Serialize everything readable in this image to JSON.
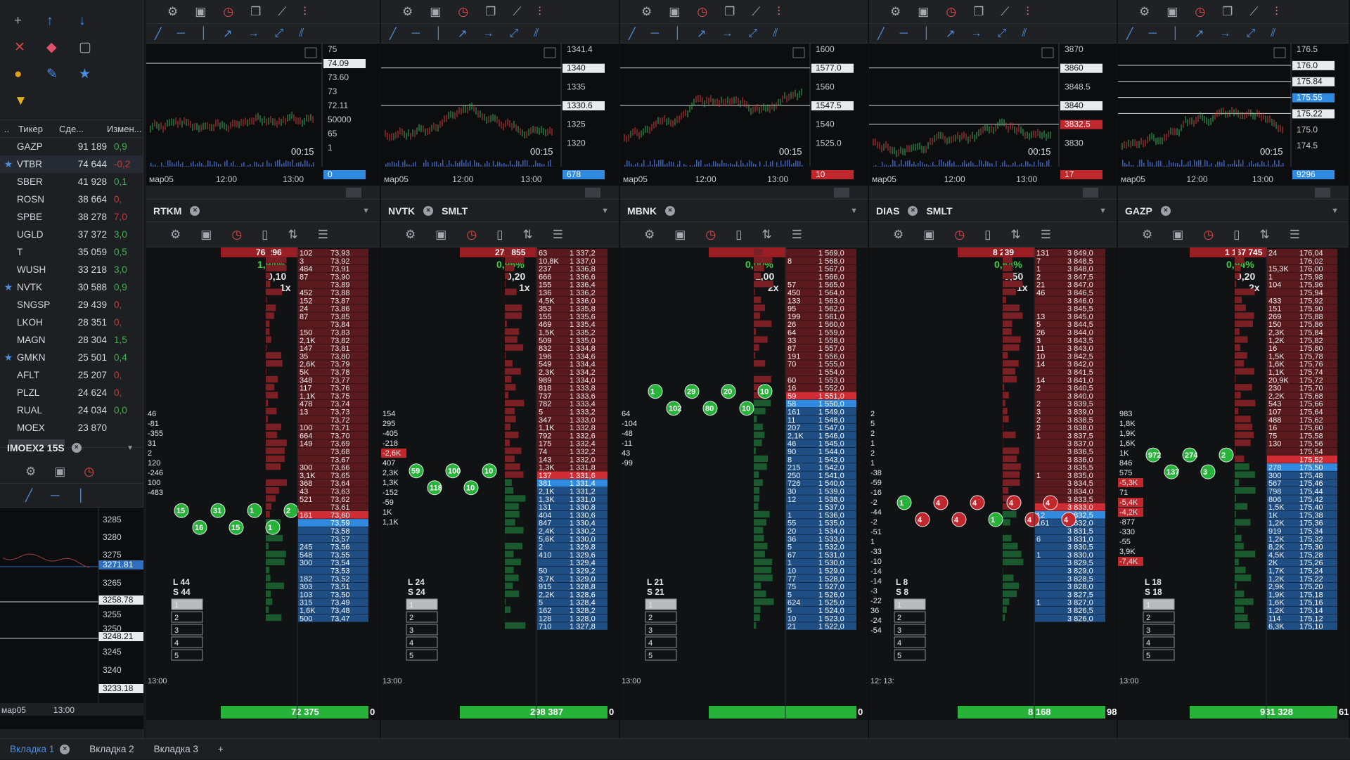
{
  "left_panel": {
    "table_headers": [
      "..",
      "Тикер",
      "Сде...",
      "Измен..."
    ],
    "tickers": [
      {
        "star": false,
        "name": "GAZP",
        "trades": "91 189",
        "change": "0,9",
        "dir": "pos"
      },
      {
        "star": true,
        "name": "VTBR",
        "trades": "74 644",
        "change": "-0,2",
        "dir": "neg"
      },
      {
        "star": false,
        "name": "SBER",
        "trades": "41 928",
        "change": "0,1",
        "dir": "pos"
      },
      {
        "star": false,
        "name": "ROSN",
        "trades": "38 664",
        "change": "0,",
        "dir": "neg"
      },
      {
        "star": false,
        "name": "SPBE",
        "trades": "38 278",
        "change": "7,0",
        "dir": "neg"
      },
      {
        "star": false,
        "name": "UGLD",
        "trades": "37 372",
        "change": "3,0",
        "dir": "pos"
      },
      {
        "star": false,
        "name": "T",
        "trades": "35 059",
        "change": "0,5",
        "dir": "pos"
      },
      {
        "star": false,
        "name": "WUSH",
        "trades": "33 218",
        "change": "3,0",
        "dir": "pos"
      },
      {
        "star": true,
        "name": "NVTK",
        "trades": "30 588",
        "change": "0,9",
        "dir": "pos"
      },
      {
        "star": false,
        "name": "SNGSP",
        "trades": "29 439",
        "change": "0,",
        "dir": "neg"
      },
      {
        "star": false,
        "name": "LKOH",
        "trades": "28 351",
        "change": "0,",
        "dir": "neg"
      },
      {
        "star": false,
        "name": "MAGN",
        "trades": "28 304",
        "change": "1,5",
        "dir": "pos"
      },
      {
        "star": true,
        "name": "GMKN",
        "trades": "25 501",
        "change": "0,4",
        "dir": "pos"
      },
      {
        "star": false,
        "name": "AFLT",
        "trades": "25 207",
        "change": "0,",
        "dir": "neg"
      },
      {
        "star": false,
        "name": "PLZL",
        "trades": "24 624",
        "change": "0,",
        "dir": "neg"
      },
      {
        "star": false,
        "name": "RUAL",
        "trades": "24 034",
        "change": "0,0",
        "dir": "pos"
      },
      {
        "star": false,
        "name": "MOEX",
        "trades": "23 870",
        "change": "",
        "dir": "pos"
      }
    ],
    "index_title": "IMOEX2 15S",
    "index_prices": [
      "3285",
      "3280",
      "3275",
      "3271.81",
      "3265",
      "3258.78",
      "3255",
      "3250",
      "3248.21",
      "3245",
      "3240",
      "3233.18"
    ],
    "index_time_labels": [
      "мар05",
      "13:00"
    ]
  },
  "columns": [
    {
      "ticker": "RTKM",
      "extra": "",
      "price_labels": [
        "75",
        "74.09",
        "73.60",
        "73",
        "72.11",
        "50000",
        "65",
        "1",
        "0"
      ],
      "time_labels": [
        "мар05",
        "12:00",
        "13:00"
      ],
      "timer": "00:15",
      "stats": {
        "volume": "76 296",
        "pct": "1,94%",
        "step": "0,10",
        "mult": "1x"
      },
      "footer_total": "72 375",
      "footer_count": "0",
      "cluster_values": [
        "15",
        "16",
        "31",
        "15",
        "1",
        "1",
        "2"
      ],
      "ls": [
        "L 44",
        "S 44"
      ],
      "left_levels": [
        "46",
        "-81",
        "-355",
        "31",
        "2",
        "120",
        "-246",
        "100",
        "-483"
      ],
      "side_time": "13:00",
      "best_ask": "73,60",
      "best_bid": "73,56",
      "ask_prices": [
        "73,93",
        "73,92",
        "73,91",
        "73,90",
        "73,89",
        "73,88",
        "73,87",
        "73,86",
        "73,85",
        "73,84",
        "73,83",
        "73,82",
        "73,81",
        "73,80",
        "73,79",
        "73,78",
        "73,77",
        "73,76",
        "73,75",
        "73,74",
        "73,73",
        "73,72",
        "73,71",
        "73,70",
        "73,69",
        "73,68",
        "73,67",
        "73,66",
        "73,65",
        "73,64",
        "73,63",
        "73,62",
        "73,61",
        "73,60"
      ],
      "ask_sizes": [
        "102",
        "3",
        "484",
        "87",
        "",
        "452",
        "152",
        "24",
        "87",
        "",
        "150",
        "2,1K",
        "147",
        "35",
        "2,6K",
        "5K",
        "348",
        "117",
        "1,1K",
        "478",
        "13",
        "",
        "100",
        "664",
        "149",
        "",
        "",
        "300",
        "3,1K",
        "368",
        "43",
        "521",
        "",
        "161"
      ],
      "bid_prices": [
        "73,59",
        "73,58",
        "73,57",
        "73,56",
        "73,55",
        "73,54",
        "73,53",
        "73,52",
        "73,51",
        "73,50",
        "73,49",
        "73,48",
        "73,47"
      ],
      "bid_sizes": [
        "",
        "",
        "",
        "245",
        "548",
        "300",
        "",
        "182",
        "303",
        "103",
        "315",
        "1,6K",
        "500"
      ]
    },
    {
      "ticker": "NVTK",
      "extra": "SMLT",
      "price_labels": [
        "1341.4",
        "1340",
        "1335",
        "1330.6",
        "1325",
        "1320",
        "678"
      ],
      "time_labels": [
        "мар05",
        "12:00",
        "13:00"
      ],
      "timer": "00:15",
      "stats": {
        "volume": "272 855",
        "pct": "0,96%",
        "step": "0,20",
        "mult": "1x"
      },
      "footer_total": "298 387",
      "footer_count": "0",
      "cluster_values": [
        "59",
        "118",
        "100",
        "10",
        "10"
      ],
      "ls": [
        "L 24",
        "S 24"
      ],
      "left_levels": [
        "154",
        "295",
        "-405",
        "-218",
        "-2,6K",
        "407",
        "2,3K",
        "1,3K",
        "-152",
        "-59",
        "1K",
        "1,1K"
      ],
      "side_time": "13:00",
      "best_ask": "1 331,6",
      "best_bid": "1 331,4",
      "ask_prices": [
        "1 337,2",
        "1 337,0",
        "1 336,8",
        "1 336,6",
        "1 336,4",
        "1 336,2",
        "1 336,0",
        "1 335,8",
        "1 335,6",
        "1 335,4",
        "1 335,2",
        "1 335,0",
        "1 334,8",
        "1 334,6",
        "1 334,4",
        "1 334,2",
        "1 334,0",
        "1 333,8",
        "1 333,6",
        "1 333,4",
        "1 333,2",
        "1 333,0",
        "1 332,8",
        "1 332,6",
        "1 332,4",
        "1 332,2",
        "1 332,0",
        "1 331,8",
        "1 331,6"
      ],
      "ask_sizes": [
        "63",
        "10,8K",
        "237",
        "666",
        "155",
        "136",
        "4,5K",
        "353",
        "155",
        "469",
        "1,5K",
        "509",
        "832",
        "196",
        "549",
        "2,3K",
        "989",
        "818",
        "737",
        "782",
        "5",
        "347",
        "1,1K",
        "792",
        "175",
        "74",
        "143",
        "1,3K",
        "137"
      ],
      "bid_prices": [
        "1 331,4",
        "1 331,2",
        "1 331,0",
        "1 330,8",
        "1 330,6",
        "1 330,4",
        "1 330,2",
        "1 330,0",
        "1 329,8",
        "1 329,6",
        "1 329,4",
        "1 329,2",
        "1 329,0",
        "1 328,8",
        "1 328,6",
        "1 328,4",
        "1 328,2",
        "1 328,0",
        "1 327,8"
      ],
      "bid_sizes": [
        "381",
        "2,1K",
        "1,3K",
        "131",
        "404",
        "847",
        "2,4K",
        "5,6K",
        "2",
        "410",
        "",
        "50",
        "3,7K",
        "915",
        "2,2K",
        "5",
        "162",
        "128",
        "710"
      ]
    },
    {
      "ticker": "MBNK",
      "extra": "",
      "price_labels": [
        "1600",
        "1577.0",
        "1560",
        "1547.5",
        "1540",
        "1525.0",
        "10"
      ],
      "time_labels": [
        "мар05",
        "12:00",
        "13:00"
      ],
      "timer": "00:15",
      "stats": {
        "volume": "",
        "pct": "0,00%",
        "step": "1,00",
        "mult": "2x"
      },
      "footer_total": "",
      "footer_count": "0",
      "cluster_values": [
        "1",
        "102",
        "29",
        "80",
        "20",
        "10",
        "10"
      ],
      "ls": [
        "L 21",
        "S 21"
      ],
      "left_levels": [
        "64",
        "-104",
        "-48",
        "-11",
        "43",
        "-99"
      ],
      "side_time": "13:00",
      "best_ask": "1 551,0",
      "best_bid": "1 550,0",
      "ask_prices": [
        "1 569,0",
        "1 568,0",
        "1 567,0",
        "1 566,0",
        "1 565,0",
        "1 564,0",
        "1 563,0",
        "1 562,0",
        "1 561,0",
        "1 560,0",
        "1 559,0",
        "1 558,0",
        "1 557,0",
        "1 556,0",
        "1 555,0",
        "1 554,0",
        "1 553,0",
        "1 552,0",
        "1 551,0"
      ],
      "ask_sizes": [
        "",
        "8",
        "",
        "",
        "57",
        "450",
        "133",
        "95",
        "199",
        "26",
        "64",
        "33",
        "87",
        "191",
        "70",
        "",
        "60",
        "16",
        "59"
      ],
      "bid_prices": [
        "1 550,0",
        "1 549,0",
        "1 548,0",
        "1 547,0",
        "1 546,0",
        "1 545,0",
        "1 544,0",
        "1 543,0",
        "1 542,0",
        "1 541,0",
        "1 540,0",
        "1 539,0",
        "1 538,0",
        "1 537,0",
        "1 536,0",
        "1 535,0",
        "1 534,0",
        "1 533,0",
        "1 532,0",
        "1 531,0",
        "1 530,0",
        "1 529,0",
        "1 528,0",
        "1 527,0",
        "1 526,0",
        "1 525,0",
        "1 524,0",
        "1 523,0",
        "1 522,0"
      ],
      "bid_sizes": [
        "58",
        "161",
        "11",
        "207",
        "2,1K",
        "46",
        "90",
        "8",
        "215",
        "250",
        "726",
        "30",
        "12",
        "",
        "1",
        "55",
        "20",
        "36",
        "5",
        "67",
        "1",
        "10",
        "77",
        "75",
        "5",
        "624",
        "5",
        "10",
        "21"
      ]
    },
    {
      "ticker": "DIAS",
      "extra": "SMLT",
      "price_labels": [
        "3870",
        "3860",
        "3848.5",
        "3840",
        "3832.5",
        "3830",
        "17"
      ],
      "time_labels": [
        "мар05",
        "12:00",
        "13:00"
      ],
      "timer": "00:15",
      "stats": {
        "volume": "8 239",
        "pct": "0,64%",
        "step": "0,50",
        "mult": "1x"
      },
      "footer_total": "8 168",
      "footer_count": "98",
      "cluster_values": [
        "1",
        "4",
        "4",
        "4",
        "4",
        "1",
        "4",
        "4",
        "4",
        "4"
      ],
      "ls": [
        "L 8",
        "S 8"
      ],
      "left_levels": [
        "2",
        "5",
        "2",
        "1",
        "2",
        "1",
        "-38",
        "-59",
        "-16",
        "-2",
        "-44",
        "-2",
        "-51",
        "1",
        "-33",
        "-10",
        "-14",
        "-14",
        "-3",
        "-22",
        "36",
        "-24",
        "-54"
      ],
      "side_time": "12: 13:",
      "best_ask": "3 835,0",
      "best_bid": "3 832,5",
      "ask_prices": [
        "3 849,0",
        "3 848,5",
        "3 848,0",
        "3 847,5",
        "3 847,0",
        "3 846,5",
        "3 846,0",
        "3 845,5",
        "3 845,0",
        "3 844,5",
        "3 844,0",
        "3 843,5",
        "3 843,0",
        "3 842,5",
        "3 842,0",
        "3 841,5",
        "3 841,0",
        "3 840,5",
        "3 840,0",
        "3 839,5",
        "3 839,0",
        "3 838,5",
        "3 838,0",
        "3 837,5",
        "3 837,0",
        "3 836,5",
        "3 836,0",
        "3 835,5",
        "3 835,0",
        "3 834,5",
        "3 834,0",
        "3 833,5",
        "3 833,0"
      ],
      "ask_sizes": [
        "131",
        "7",
        "1",
        "2",
        "21",
        "46",
        "",
        "",
        "13",
        "5",
        "26",
        "3",
        "11",
        "10",
        "14",
        "",
        "14",
        "2",
        "",
        "2",
        "3",
        "2",
        "2",
        "1",
        "",
        "",
        "",
        "",
        "1",
        "",
        "",
        "",
        ""
      ],
      "bid_prices": [
        "3 832,5",
        "3 832,0",
        "3 831,5",
        "3 831,0",
        "3 830,5",
        "3 830,0",
        "3 829,5",
        "3 829,0",
        "3 828,5",
        "3 828,0",
        "3 827,5",
        "3 827,0",
        "3 826,5",
        "3 826,0"
      ],
      "bid_sizes": [
        "12",
        "161",
        "",
        "6",
        "",
        "1",
        "",
        "",
        "",
        "",
        "",
        "1",
        "",
        ""
      ]
    },
    {
      "ticker": "GAZP",
      "extra": "",
      "price_labels": [
        "176.5",
        "176.0",
        "175.84",
        "175.55",
        "175.22",
        "175.0",
        "174.5",
        "9296"
      ],
      "time_labels": [
        "мар05",
        "12:00",
        "13:00"
      ],
      "timer": "00:15",
      "stats": {
        "volume": "1 167 745",
        "pct": "0,94%",
        "step": "0,20",
        "mult": "2x"
      },
      "footer_total": "931 328",
      "footer_count": "61",
      "cluster_values": [
        "972",
        "137",
        "274",
        "3",
        "2"
      ],
      "ls": [
        "L 18",
        "S 18"
      ],
      "left_levels": [
        "983",
        "1,8K",
        "1,9K",
        "1,6K",
        "1K",
        "846",
        "575",
        "-5,3K",
        "71",
        "-5,4K",
        "-4,2K",
        "-877",
        "-330",
        "-55",
        "3,9K",
        "-7,4K"
      ],
      "side_time": "13:00",
      "best_ask": "175,54",
      "best_bid": "175,50",
      "ask_prices": [
        "176,04",
        "176,02",
        "176,00",
        "175,98",
        "175,96",
        "175,94",
        "175,92",
        "175,90",
        "175,88",
        "175,86",
        "175,84",
        "175,82",
        "175,80",
        "175,78",
        "175,76",
        "175,74",
        "175,72",
        "175,70",
        "175,68",
        "175,66",
        "175,64",
        "175,62",
        "175,60",
        "175,58",
        "175,56",
        "175,54",
        "175,52"
      ],
      "ask_sizes": [
        "24",
        "",
        "15,3K",
        "1",
        "104",
        "",
        "433",
        "151",
        "269",
        "150",
        "2,3K",
        "1,2K",
        "16",
        "1,5K",
        "1,6K",
        "1,1K",
        "20,9K",
        "230",
        "2,2K",
        "543",
        "107",
        "488",
        "16",
        "75",
        "130",
        "",
        ""
      ],
      "bid_prices": [
        "175,50",
        "175,48",
        "175,46",
        "175,44",
        "175,42",
        "175,40",
        "175,38",
        "175,36",
        "175,34",
        "175,32",
        "175,30",
        "175,28",
        "175,26",
        "175,24",
        "175,22",
        "175,20",
        "175,18",
        "175,16",
        "175,14",
        "175,12",
        "175,10"
      ],
      "bid_sizes": [
        "278",
        "300",
        "567",
        "798",
        "806",
        "1,5K",
        "1K",
        "1,2K",
        "919",
        "1,2K",
        "8,2K",
        "4,5K",
        "2K",
        "1,7K",
        "1,2K",
        "2,9K",
        "1,9K",
        "1,6K",
        "1,2K",
        "114",
        "6,3K"
      ]
    }
  ],
  "tabs": [
    "Вкладка 1",
    "Вкладка 2",
    "Вкладка 3",
    "+"
  ],
  "colors": {
    "ask_bg": "#5a1a1d",
    "bid_bg": "#1e4e83",
    "accent_blue": "#4b8de0",
    "green": "#39b54a",
    "red": "#d03838"
  }
}
